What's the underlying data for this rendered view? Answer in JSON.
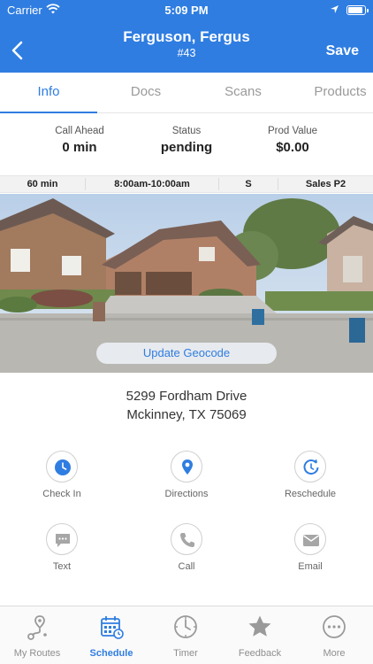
{
  "status_bar": {
    "carrier": "Carrier",
    "time": "5:09 PM"
  },
  "nav": {
    "title": "Ferguson, Fergus",
    "subtitle": "#43",
    "save_label": "Save"
  },
  "tabs": [
    {
      "label": "Info",
      "active": true
    },
    {
      "label": "Docs",
      "active": false
    },
    {
      "label": "Scans",
      "active": false
    },
    {
      "label": "Products",
      "active": false
    }
  ],
  "stats": [
    {
      "label": "Call Ahead",
      "value": "0 min"
    },
    {
      "label": "Status",
      "value": "pending"
    },
    {
      "label": "Prod Value",
      "value": "$0.00"
    }
  ],
  "info_row": [
    "60 min",
    "8:00am-10:00am",
    "S",
    "Sales P2"
  ],
  "photo": {
    "geocode_button": "Update Geocode"
  },
  "address": {
    "line1": "5299 Fordham Drive",
    "line2": "Mckinney, TX 75069"
  },
  "actions": [
    {
      "label": "Check In",
      "icon": "clock-icon"
    },
    {
      "label": "Directions",
      "icon": "map-pin-icon"
    },
    {
      "label": "Reschedule",
      "icon": "reschedule-icon"
    },
    {
      "label": "Text",
      "icon": "message-icon"
    },
    {
      "label": "Call",
      "icon": "phone-icon"
    },
    {
      "label": "Email",
      "icon": "mail-icon"
    }
  ],
  "tabbar": [
    {
      "label": "My Routes",
      "icon": "route-icon",
      "active": false
    },
    {
      "label": "Schedule",
      "icon": "calendar-icon",
      "active": true
    },
    {
      "label": "Timer",
      "icon": "timer-icon",
      "active": false
    },
    {
      "label": "Feedback",
      "icon": "star-icon",
      "active": false
    },
    {
      "label": "More",
      "icon": "more-icon",
      "active": false
    }
  ],
  "colors": {
    "accent": "#2f7de1",
    "header_bg": "#2f7de1",
    "inactive": "#9a9a9a"
  }
}
